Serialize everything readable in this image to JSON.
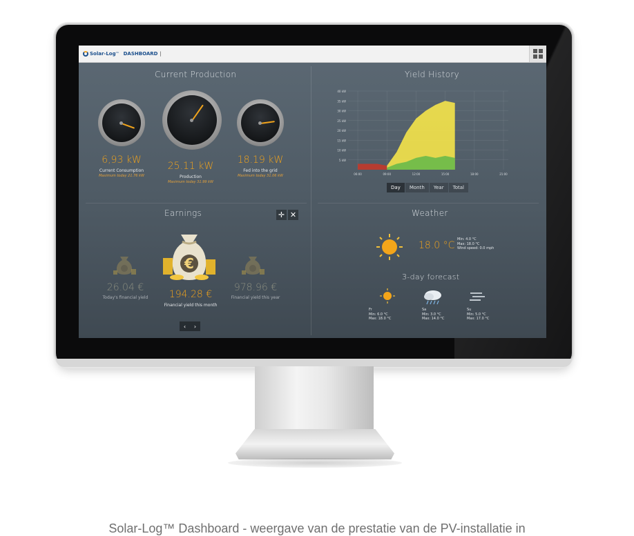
{
  "header": {
    "logo_text": "Solar-Log",
    "tm": "™",
    "dashboard_label": "DASHBOARD",
    "separator": "|"
  },
  "production": {
    "title": "Current Production",
    "gauges": [
      {
        "value": "6,93 kW",
        "label": "Current Consumption",
        "max": "Maximum today 21.76 kW"
      },
      {
        "value": "25.11 kW",
        "label": "Production",
        "max": "Maximum today 31.99 kW"
      },
      {
        "value": "18.19 kW",
        "label": "Fed into the grid",
        "max": "Maximum today 31.06 kW"
      }
    ]
  },
  "yield": {
    "title": "Yield History",
    "tabs": [
      "Day",
      "Month",
      "Year",
      "Total"
    ],
    "active_tab": "Day"
  },
  "chart_data": {
    "type": "area",
    "title": "Yield History",
    "y_ticks": [
      "40 kW",
      "35 kW",
      "30 kW",
      "25 kW",
      "20 kW",
      "15 kW",
      "10 kW",
      "5 kW"
    ],
    "x_ticks": [
      "06:00",
      "09:00",
      "12:00",
      "15:00",
      "18:00",
      "21:00"
    ],
    "ylim": [
      0,
      40
    ],
    "series": [
      {
        "color": "#f2e24b",
        "x": [
          "09:00",
          "10:00",
          "11:00",
          "12:00",
          "13:00",
          "14:00",
          "15:00",
          "16:00"
        ],
        "values": [
          2,
          9,
          19,
          26,
          30,
          33,
          35,
          34
        ]
      },
      {
        "color": "#6dbb4a",
        "x": [
          "09:00",
          "10:00",
          "11:00",
          "12:00",
          "13:00",
          "14:00",
          "15:00",
          "16:00"
        ],
        "values": [
          1,
          3,
          4,
          6,
          7,
          6,
          7,
          6
        ]
      },
      {
        "color": "#c0392b",
        "x": [
          "06:00",
          "07:00",
          "08:00",
          "09:00"
        ],
        "values": [
          3,
          3,
          3,
          2
        ]
      }
    ]
  },
  "earnings": {
    "title": "Earnings",
    "items": [
      {
        "value": "26.04 €",
        "label": "Today's financial yield"
      },
      {
        "value": "194.28 €",
        "label": "Financial yield this month"
      },
      {
        "value": "978.96 €",
        "label": "Financial yield this year"
      }
    ],
    "pager_prev": "‹",
    "pager_next": "›"
  },
  "weather": {
    "title": "Weather",
    "temp": "18.0 °C",
    "min": "Min: 4.0 °C",
    "max": "Max: 18.0 °C",
    "wind": "Wind speed: 0.0 mph",
    "forecast_title": "3-day forecast",
    "forecast": [
      {
        "day": "Fr",
        "min": "Min: 6.0 °C",
        "max": "Max: 18.0 °C",
        "icon": "sun-icon"
      },
      {
        "day": "Sa",
        "min": "Min: 3.0 °C",
        "max": "Max: 14.0 °C",
        "icon": "rain-cloud-icon"
      },
      {
        "day": "Su",
        "min": "Min: 5.0 °C",
        "max": "Max: 17.0 °C",
        "icon": "fog-icon"
      }
    ]
  },
  "controls": {
    "move": "✛",
    "close": "✕"
  },
  "caption": "Solar-Log™ Dashboard - weergave van de prestatie van de PV-installatie in"
}
